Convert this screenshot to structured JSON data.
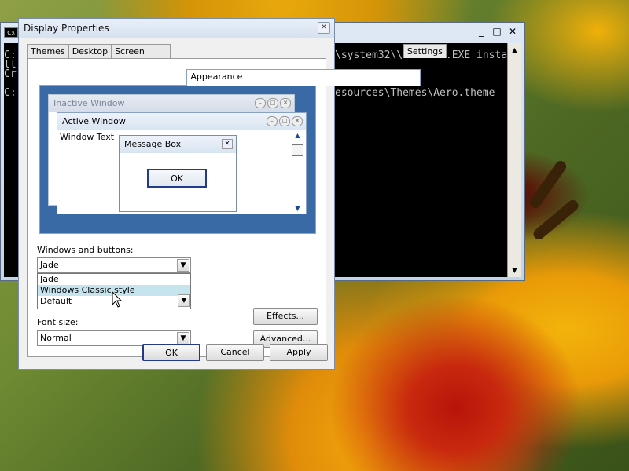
{
  "console": {
    "icon_label": "C:\\",
    "lines": [
      "C:",
      "ll",
      "Cr",
      "",
      "C:"
    ],
    "text_line1": "\\system32\\\\INSTSRV.EXE insta",
    "text_line2": "esources\\Themes\\Aero.theme",
    "controls": {
      "minimize": "_",
      "maximize": "□",
      "close": "✕"
    }
  },
  "dialog": {
    "title": "Display Properties",
    "close_glyph": "✕",
    "tabs": [
      "Themes",
      "Desktop",
      "Screen Saver",
      "Appearance",
      "Settings"
    ],
    "active_tab": "Appearance",
    "preview": {
      "inactive_title": "Inactive Window",
      "active_title": "Active Window",
      "window_text": "Window Text",
      "message_box_title": "Message Box",
      "message_box_ok": "OK"
    },
    "windows_buttons_label": "Windows and buttons:",
    "windows_buttons_value": "Jade",
    "dropdown_options": [
      "Jade",
      "Windows Classic style",
      "Default"
    ],
    "dropdown_selected": "Windows Classic style",
    "font_size_label": "Font size:",
    "font_size_value": "Normal",
    "effects_label": "Effects...",
    "advanced_label": "Advanced...",
    "ok_label": "OK",
    "cancel_label": "Cancel",
    "apply_label": "Apply"
  },
  "icons": {
    "dropdown_arrow": "▼",
    "scroll_up": "▲",
    "scroll_down": "▼"
  },
  "colors": {
    "preview_bg": "#3a6aa6",
    "selection": "#c6e4ee",
    "console_bg": "#000000"
  }
}
